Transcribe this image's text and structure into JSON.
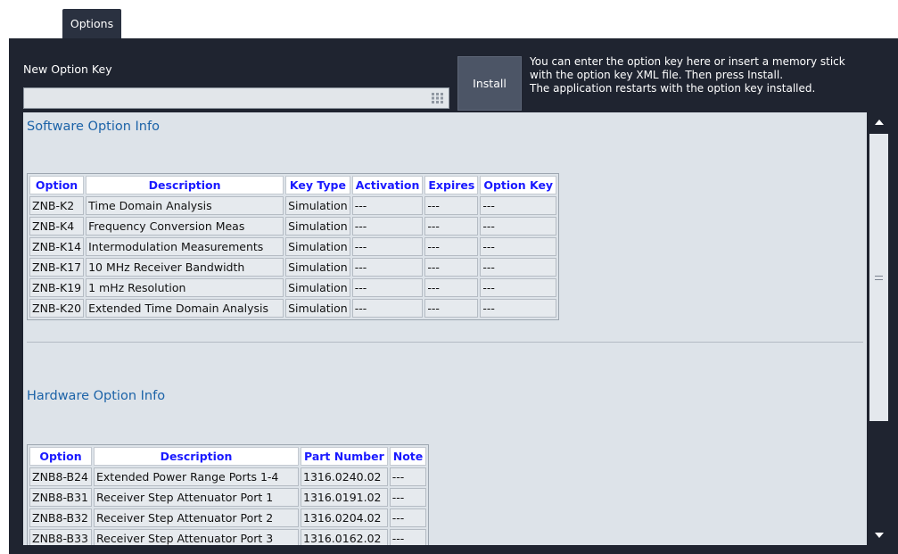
{
  "tab": {
    "label": "Options"
  },
  "option_key": {
    "label": "New Option Key",
    "value": "",
    "keypad_icon": "keypad-icon"
  },
  "install": {
    "label": "Install",
    "help_lines": [
      "You can enter the option key here or insert a memory stick",
      "with the option key XML file.  Then press Install.",
      "The application restarts with the option key installed."
    ]
  },
  "software": {
    "title": "Software Option Info",
    "columns": [
      "Option",
      "Description",
      "Key Type",
      "Activation",
      "Expires",
      "Option Key"
    ],
    "rows": [
      [
        "ZNB-K2",
        "Time Domain Analysis",
        "Simulation",
        "---",
        "---",
        "---"
      ],
      [
        "ZNB-K4",
        "Frequency Conversion Meas",
        "Simulation",
        "---",
        "---",
        "---"
      ],
      [
        "ZNB-K14",
        "Intermodulation Measurements",
        "Simulation",
        "---",
        "---",
        "---"
      ],
      [
        "ZNB-K17",
        "10 MHz Receiver Bandwidth",
        "Simulation",
        "---",
        "---",
        "---"
      ],
      [
        "ZNB-K19",
        "1 mHz Resolution",
        "Simulation",
        "---",
        "---",
        "---"
      ],
      [
        "ZNB-K20",
        "Extended Time Domain Analysis",
        "Simulation",
        "---",
        "---",
        "---"
      ]
    ]
  },
  "hardware": {
    "title": "Hardware Option Info",
    "columns": [
      "Option",
      "Description",
      "Part Number",
      "Note"
    ],
    "rows": [
      [
        "ZNB8-B24",
        "Extended Power Range Ports 1-4",
        "1316.0240.02",
        "---"
      ],
      [
        "ZNB8-B31",
        "Receiver Step Attenuator Port 1",
        "1316.0191.02",
        "---"
      ],
      [
        "ZNB8-B32",
        "Receiver Step Attenuator Port 2",
        "1316.0204.02",
        "---"
      ],
      [
        "ZNB8-B33",
        "Receiver Step Attenuator Port 3",
        "1316.0162.02",
        "---"
      ]
    ]
  },
  "scrollbar": {
    "up_icon": "arrow-up-icon",
    "down_icon": "arrow-down-icon",
    "grip_icon": "grip-icon"
  }
}
